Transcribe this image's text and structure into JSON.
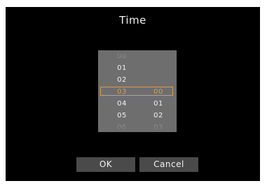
{
  "dialog": {
    "title": "Time"
  },
  "picker": {
    "hours": [
      "00",
      "01",
      "02",
      "03",
      "04",
      "05",
      "06"
    ],
    "minutes": [
      "",
      "",
      "",
      "00",
      "01",
      "02",
      "03"
    ],
    "selected": {
      "hour": "03",
      "minute": "00"
    }
  },
  "buttons": {
    "ok": "OK",
    "cancel": "Cancel"
  },
  "colors": {
    "background": "#000000",
    "picker": "#6e6e6e",
    "accent": "#e09a4a",
    "button": "#4a4a4a"
  }
}
